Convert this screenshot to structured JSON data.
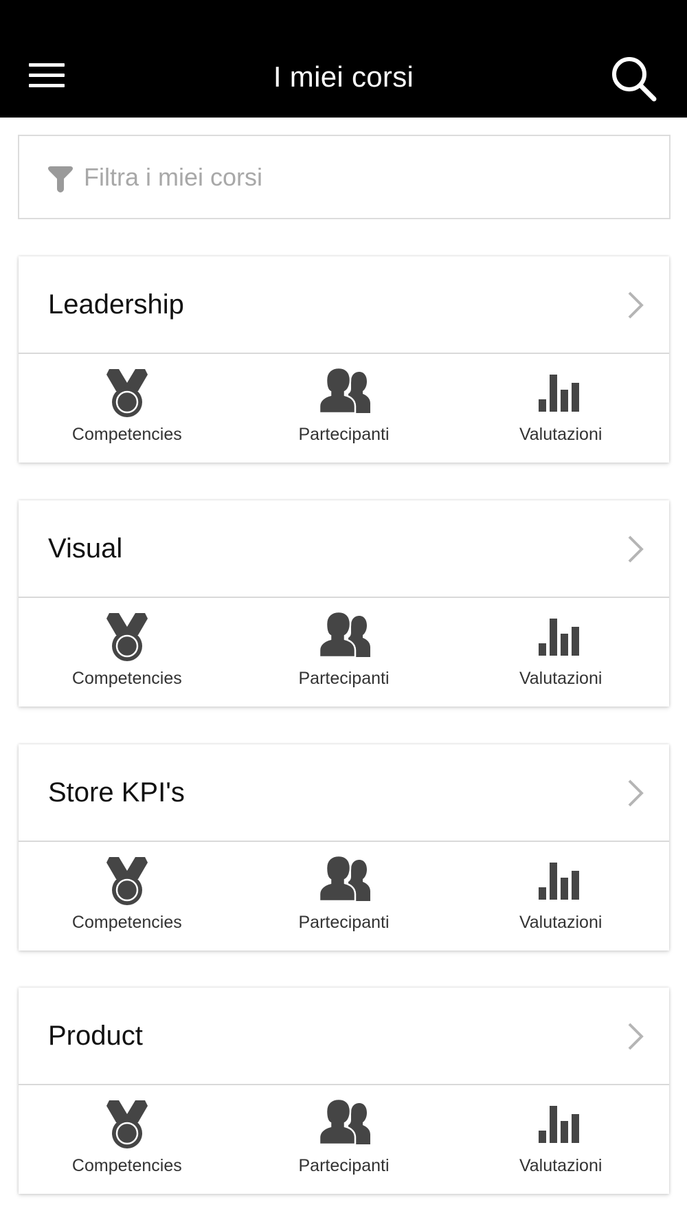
{
  "header": {
    "title": "I miei corsi",
    "menu_icon": "hamburger-menu-icon",
    "search_icon": "search-icon"
  },
  "filter": {
    "placeholder": "Filtra i miei corsi",
    "value": "",
    "icon": "funnel-icon"
  },
  "courses": [
    {
      "title": "Leadership",
      "actions": [
        "Competencies",
        "Partecipanti",
        "Valutazioni"
      ]
    },
    {
      "title": "Visual",
      "actions": [
        "Competencies",
        "Partecipanti",
        "Valutazioni"
      ]
    },
    {
      "title": "Store KPI's",
      "actions": [
        "Competencies",
        "Partecipanti",
        "Valutazioni"
      ]
    },
    {
      "title": "Product",
      "actions": [
        "Competencies",
        "Partecipanti",
        "Valutazioni"
      ]
    }
  ],
  "icons": {
    "competencies": "medal-icon",
    "partecipanti": "users-icon",
    "valutazioni": "bar-chart-icon",
    "open": "chevron-right-icon"
  },
  "colors": {
    "header_bg": "#000000",
    "header_text": "#ffffff",
    "icon_gray": "#454545",
    "chevron_gray": "#b5b5b5",
    "placeholder_gray": "#a8a8a8",
    "divider": "#d9d9d9"
  }
}
